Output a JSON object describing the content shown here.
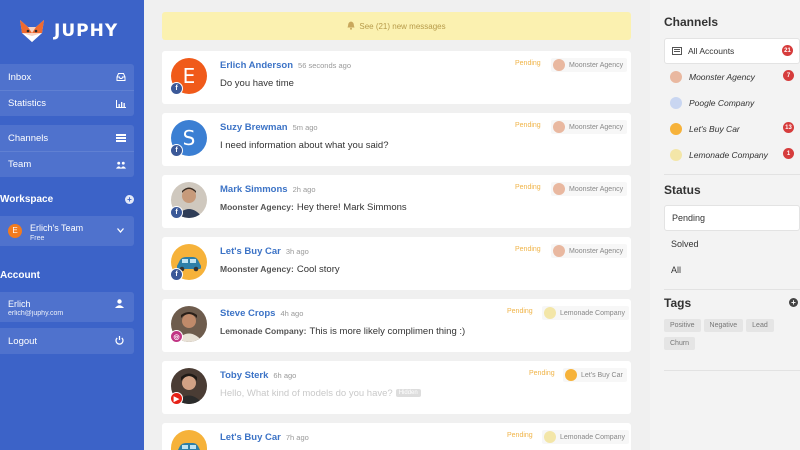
{
  "app": {
    "brand": "JUPHY"
  },
  "nav": {
    "inbox": "Inbox",
    "statistics": "Statistics",
    "channels": "Channels",
    "team": "Team"
  },
  "workspace": {
    "title": "Workspace",
    "team_name": "Erlich's Team",
    "team_plan": "Free",
    "team_initial": "E"
  },
  "account": {
    "title": "Account",
    "name": "Erlich",
    "email": "erlich@juphy.com",
    "logout": "Logout"
  },
  "banner": {
    "text": "See (21) new messages"
  },
  "messages": [
    {
      "name": "Erlich Anderson",
      "time": "56 seconds ago",
      "prefix": "",
      "text": "Do you have time",
      "status": "Pending",
      "channel": "Moonster Agency",
      "avatar_letter": "E",
      "avatar_color": "#f05a1a",
      "network": "facebook"
    },
    {
      "name": "Suzy Brewman",
      "time": "5m ago",
      "prefix": "",
      "text": "I need information about what you said?",
      "status": "Pending",
      "channel": "Moonster Agency",
      "avatar_letter": "S",
      "avatar_color": "#3b7fd3",
      "network": "facebook"
    },
    {
      "name": "Mark Simmons",
      "time": "2h ago",
      "prefix": "Moonster Agency:",
      "text": "Hey there! Mark Simmons",
      "status": "Pending",
      "channel": "Moonster Agency",
      "avatar_letter": "",
      "avatar_color": "#b9b1a5",
      "network": "facebook"
    },
    {
      "name": "Let's Buy Car",
      "time": "3h ago",
      "prefix": "Moonster Agency:",
      "text": "Cool story",
      "status": "Pending",
      "channel": "Moonster Agency",
      "avatar_letter": "",
      "avatar_color": "#f6b23a",
      "network": "facebook"
    },
    {
      "name": "Steve Crops",
      "time": "4h ago",
      "prefix": "Lemonade Company:",
      "text": "This is more likely complimen thing :)",
      "status": "Pending",
      "channel": "Lemonade Company",
      "avatar_letter": "",
      "avatar_color": "#5d4a3d",
      "network": "instagram"
    },
    {
      "name": "Toby Sterk",
      "time": "6h ago",
      "prefix": "",
      "text": "Hello, What kind of models do you have?",
      "hidden": "Hidden",
      "status": "Pending",
      "channel": "Let's Buy Car",
      "avatar_letter": "",
      "avatar_color": "#4a3c34",
      "network": "youtube"
    },
    {
      "name": "Let's Buy Car",
      "time": "7h ago",
      "prefix": "",
      "text": "",
      "status": "Pending",
      "channel": "Lemonade Company",
      "avatar_letter": "",
      "avatar_color": "#f6b23a",
      "network": "facebook"
    }
  ],
  "right": {
    "channels_title": "Channels",
    "channels": [
      {
        "label": "All Accounts",
        "count": "21"
      },
      {
        "label": "Moonster Agency",
        "count": "7"
      },
      {
        "label": "Poogle Company",
        "count": ""
      },
      {
        "label": "Let's Buy Car",
        "count": "13"
      },
      {
        "label": "Lemonade Company",
        "count": "1"
      }
    ],
    "status_title": "Status",
    "statuses": [
      "Pending",
      "Solved",
      "All"
    ],
    "tags_title": "Tags",
    "tags": [
      "Positive",
      "Negative",
      "Lead",
      "Churn"
    ]
  },
  "colors": {
    "sidebar": "#3c63c8",
    "accent_name": "#3c73c6",
    "pending": "#f0b448",
    "banner_bg": "#fbf1b0",
    "badge_red": "#d63c3c",
    "facebook": "#3b5998",
    "instagram": "#c13584",
    "youtube": "#e62117"
  }
}
